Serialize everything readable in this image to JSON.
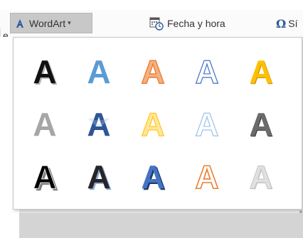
{
  "ribbon": {
    "wordart_label": "WordArt",
    "wordart_caret": "▾",
    "fecha_label": "Fecha y hora",
    "simbolo_label": "Sí",
    "omega_glyph": "Ω",
    "left_clip_text": "e"
  },
  "gallery": {
    "letter": "A",
    "styles": [
      {
        "name": "fill-black-shadow",
        "fill": "#111111",
        "stroke": "#111111"
      },
      {
        "name": "fill-blue-gradient",
        "fill": "#5b9bd5",
        "stroke": "#5b9bd5"
      },
      {
        "name": "fill-orange-outline",
        "fill": "#f4b183",
        "stroke": "#ed7d31"
      },
      {
        "name": "outline-blue-white",
        "fill": "#ffffff",
        "stroke": "#4472c4"
      },
      {
        "name": "fill-gold",
        "fill": "#ffc000",
        "stroke": "#bf8f00"
      },
      {
        "name": "fill-gray",
        "fill": "#a6a6a6",
        "stroke": "#a6a6a6"
      },
      {
        "name": "fill-blue-reflection",
        "fill": "#2f5597",
        "stroke": "#2f5597"
      },
      {
        "name": "fill-yellow-outline",
        "fill": "#ffe699",
        "stroke": "#ffc000"
      },
      {
        "name": "outline-lightblue",
        "fill": "#ffffff",
        "stroke": "#9dc3e6"
      },
      {
        "name": "fill-darkgray-bevel",
        "fill": "#6b6b6b",
        "stroke": "#555555"
      },
      {
        "name": "fill-black-outline-shadow",
        "fill": "#000000",
        "stroke": "#000000"
      },
      {
        "name": "fill-black-blue-shadow",
        "fill": "#262626",
        "stroke": "#262626"
      },
      {
        "name": "fill-blue-3d",
        "fill": "#4472c4",
        "stroke": "#2f5597"
      },
      {
        "name": "outline-orange-white",
        "fill": "#ffffff",
        "stroke": "#ed7d31"
      },
      {
        "name": "fill-silver-gradient",
        "fill": "#e0e0e0",
        "stroke": "#bfbfbf"
      }
    ]
  }
}
